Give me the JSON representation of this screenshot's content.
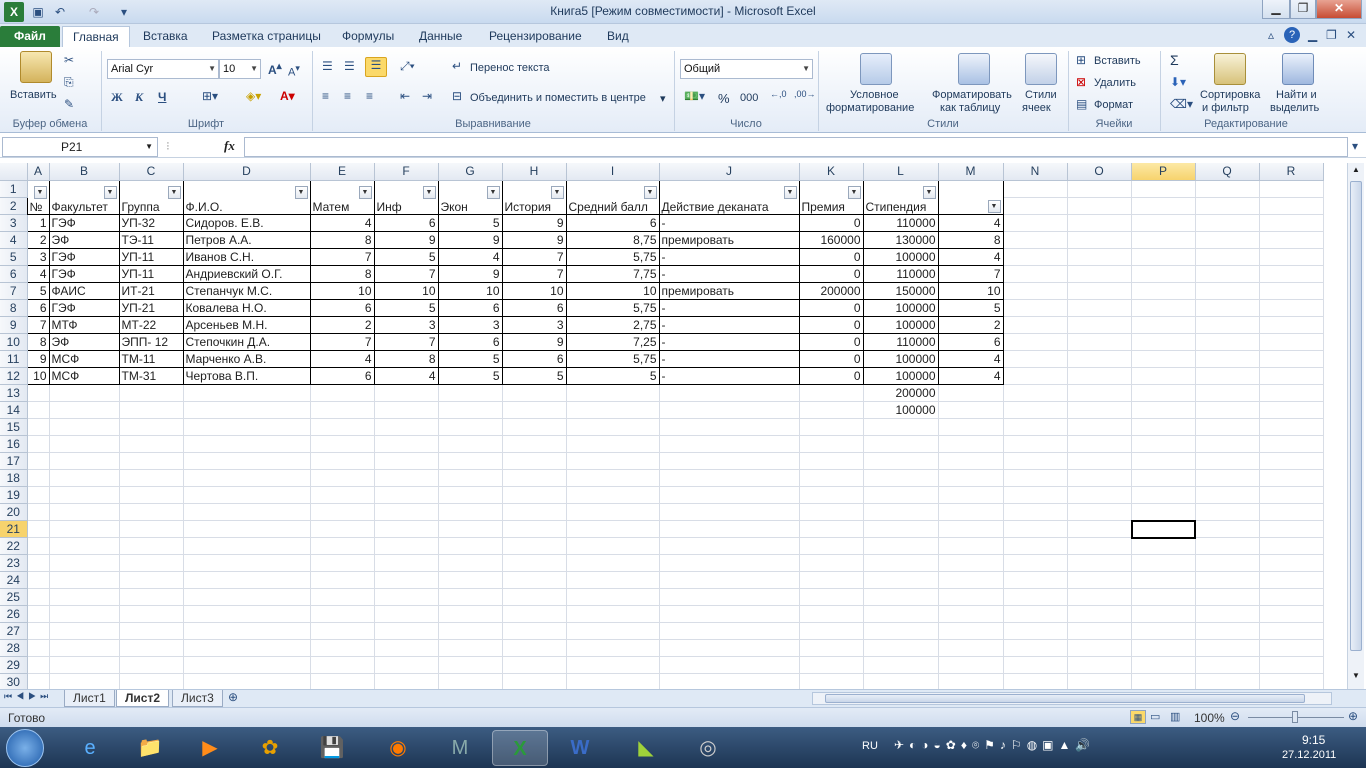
{
  "window": {
    "title": "Книга5  [Режим совместимости]  -  Microsoft Excel"
  },
  "tabs": [
    "Файл",
    "Главная",
    "Вставка",
    "Разметка страницы",
    "Формулы",
    "Данные",
    "Рецензирование",
    "Вид"
  ],
  "ribbon": {
    "paste": "Вставить",
    "clipboard": "Буфер обмена",
    "font_name": "Arial Cyr",
    "font_size": "10",
    "font_group": "Шрифт",
    "bold": "Ж",
    "italic": "К",
    "underline": "Ч",
    "wrap_text": "Перенос текста",
    "merge_center": "Объединить и поместить в центре",
    "alignment": "Выравнивание",
    "number_format": "Общий",
    "number": "Число",
    "percent": "%",
    "thousands": "000",
    "cond_format_1": "Условное",
    "cond_format_2": "форматирование",
    "format_table_1": "Форматировать",
    "format_table_2": "как таблицу",
    "cell_styles_1": "Стили",
    "cell_styles_2": "ячеек",
    "styles": "Стили",
    "insert": "Вставить",
    "delete": "Удалить",
    "format": "Формат",
    "cells": "Ячейки",
    "sort_1": "Сортировка",
    "sort_2": "и фильтр",
    "find_1": "Найти и",
    "find_2": "выделить",
    "editing": "Редактирование",
    "sigma": "Σ"
  },
  "formula_bar": {
    "name_box": "P21",
    "fx": "fx",
    "value": ""
  },
  "columns": [
    "A",
    "B",
    "C",
    "D",
    "E",
    "F",
    "G",
    "H",
    "I",
    "J",
    "K",
    "L",
    "M",
    "N",
    "O",
    "P",
    "Q",
    "R"
  ],
  "header_row": {
    "A": "№",
    "B": "Факультет",
    "C": "Группа",
    "D": "Ф.И.О.",
    "E": "Матем",
    "F": "Инф",
    "G": "Экон",
    "H": "История",
    "I": "Средний балл",
    "J": "Действие деканата",
    "K": "Премия",
    "L": "Стипендия",
    "M": ""
  },
  "rows": [
    [
      "1",
      "ГЭФ",
      "УП-32",
      "Сидоров. Е.В.",
      "4",
      "6",
      "5",
      "9",
      "6",
      "-",
      "0",
      "110000",
      "4"
    ],
    [
      "2",
      "ЭФ",
      "ТЭ-11",
      "Петров А.А.",
      "8",
      "9",
      "9",
      "9",
      "8,75",
      "премировать",
      "160000",
      "130000",
      "8"
    ],
    [
      "3",
      "ГЭФ",
      "УП-11",
      "Иванов С.Н.",
      "7",
      "5",
      "4",
      "7",
      "5,75",
      "-",
      "0",
      "100000",
      "4"
    ],
    [
      "4",
      "ГЭФ",
      "УП-11",
      "Андриевский О.Г.",
      "8",
      "7",
      "9",
      "7",
      "7,75",
      "-",
      "0",
      "110000",
      "7"
    ],
    [
      "5",
      "ФАИС",
      "ИТ-21",
      "Степанчук М.С.",
      "10",
      "10",
      "10",
      "10",
      "10",
      "премировать",
      "200000",
      "150000",
      "10"
    ],
    [
      "6",
      "ГЭФ",
      "УП-21",
      "Ковалева Н.О.",
      "6",
      "5",
      "6",
      "6",
      "5,75",
      "-",
      "0",
      "100000",
      "5"
    ],
    [
      "7",
      "МТФ",
      "МТ-22",
      "Арсеньев М.Н.",
      "2",
      "3",
      "3",
      "3",
      "2,75",
      "-",
      "0",
      "100000",
      "2"
    ],
    [
      "8",
      "ЭФ",
      "ЭПП- 12",
      "Степочкин Д.А.",
      "7",
      "7",
      "6",
      "9",
      "7,25",
      "-",
      "0",
      "110000",
      "6"
    ],
    [
      "9",
      "МСФ",
      "ТМ-11",
      "Марченко А.В.",
      "4",
      "8",
      "5",
      "6",
      "5,75",
      "-",
      "0",
      "100000",
      "4"
    ],
    [
      "10",
      "МСФ",
      "ТМ-31",
      "Чертова В.П.",
      "6",
      "4",
      "5",
      "5",
      "5",
      "-",
      "0",
      "100000",
      "4"
    ]
  ],
  "extra_L": [
    "200000",
    "100000"
  ],
  "row_numbers": [
    "1",
    "2",
    "3",
    "4",
    "5",
    "6",
    "7",
    "8",
    "9",
    "10",
    "11",
    "12",
    "13",
    "14",
    "15",
    "16",
    "17",
    "18",
    "19",
    "20",
    "21",
    "22",
    "23",
    "24",
    "25",
    "26",
    "27",
    "28",
    "29",
    "30"
  ],
  "sheets": [
    "Лист1",
    "Лист2",
    "Лист3"
  ],
  "status": {
    "ready": "Готово",
    "zoom": "100%"
  },
  "taskbar": {
    "lang": "RU",
    "time": "9:15",
    "date": "27.12.2011"
  }
}
